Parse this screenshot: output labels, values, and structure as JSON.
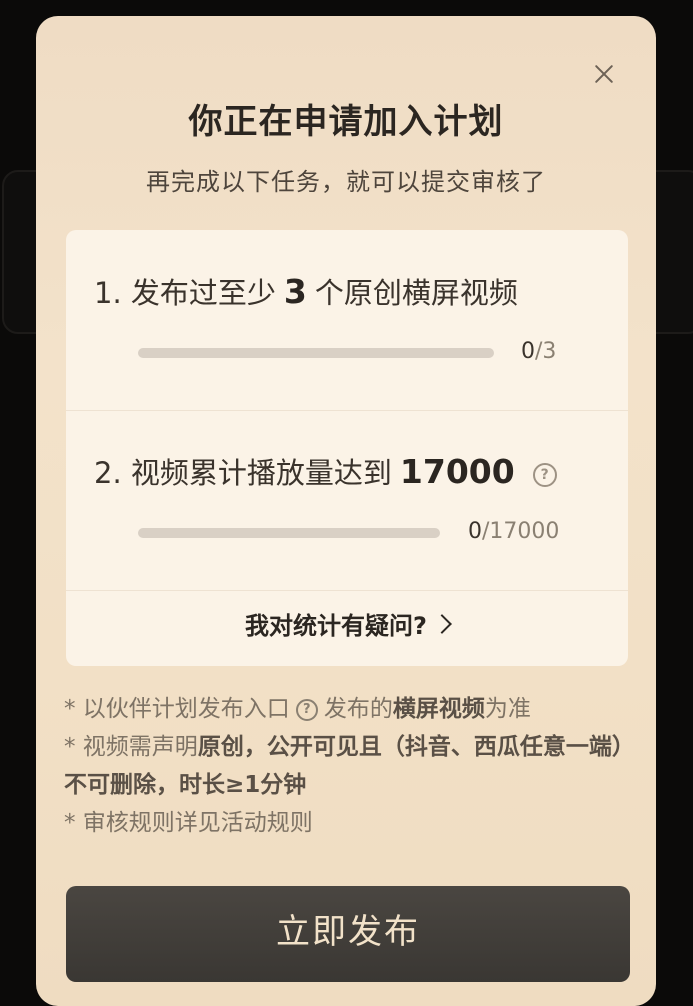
{
  "modal": {
    "title": "你正在申请加入计划",
    "subtitle": "再完成以下任务，就可以提交审核了",
    "close_icon": "close-icon"
  },
  "tasks": [
    {
      "prefix": "1. 发布过至少",
      "number": "3",
      "suffix": "个原创横屏视频",
      "progress_current": "0",
      "progress_total": "/3",
      "progress_fraction": 0
    },
    {
      "prefix": "2. 视频累计播放量达到",
      "number": "17000",
      "help_icon": "question-circle-icon",
      "progress_current": "0",
      "progress_total": "/17000",
      "progress_fraction": 0
    }
  ],
  "question_link": "我对统计有疑问?",
  "notes": {
    "line1_a": "* 以伙伴计划发布入口",
    "line1_b": "发布的",
    "line1_hl": "横屏视频",
    "line1_c": "为准",
    "line2_a": "* 视频需声明",
    "line2_hl": "原创",
    "line2_b": "，公开可见且（抖音、西瓜任意一端）不可删除，时长≥1分钟",
    "line3": "* 审核规则详见活动规则"
  },
  "publish_button": "立即发布"
}
